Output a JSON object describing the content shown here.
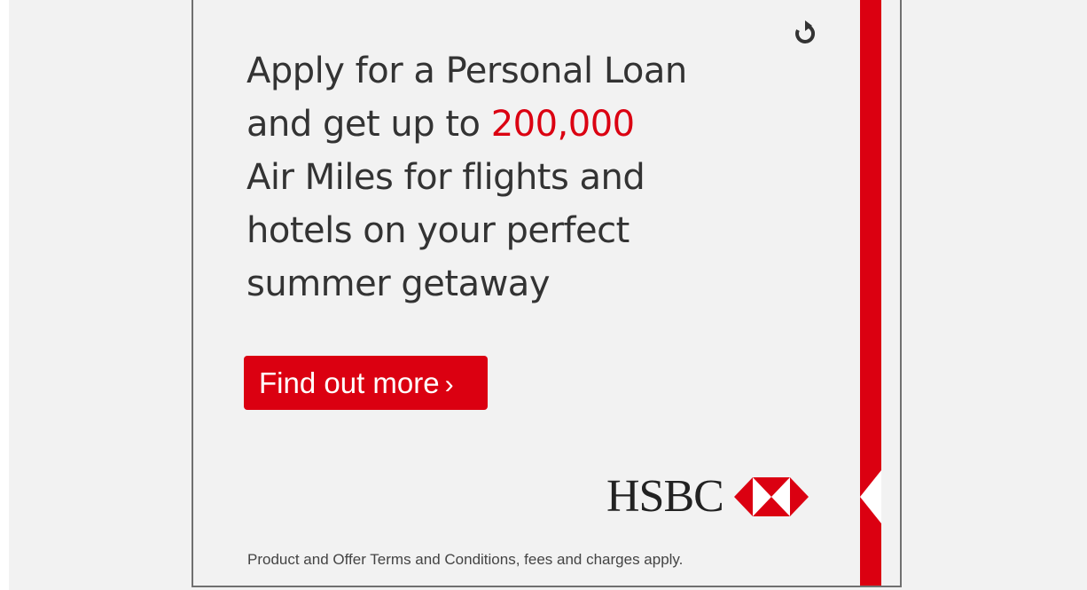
{
  "ad": {
    "headline_lines": [
      "Apply for a Personal Loan",
      "and get up to ",
      "Air Miles for flights and",
      "hotels on your perfect",
      "summer getaway"
    ],
    "highlight": "200,000",
    "cta_label": "Find out more",
    "cta_chevron": "›",
    "brand_name": "HSBC",
    "disclaimer": "Product and Offer Terms and Conditions, fees and charges apply.",
    "replay_icon": "replay-icon",
    "logo_icon": "hsbc-hexagon-icon"
  },
  "colors": {
    "brand_red": "#db0011",
    "text": "#333333",
    "background": "#f2f2f2"
  }
}
